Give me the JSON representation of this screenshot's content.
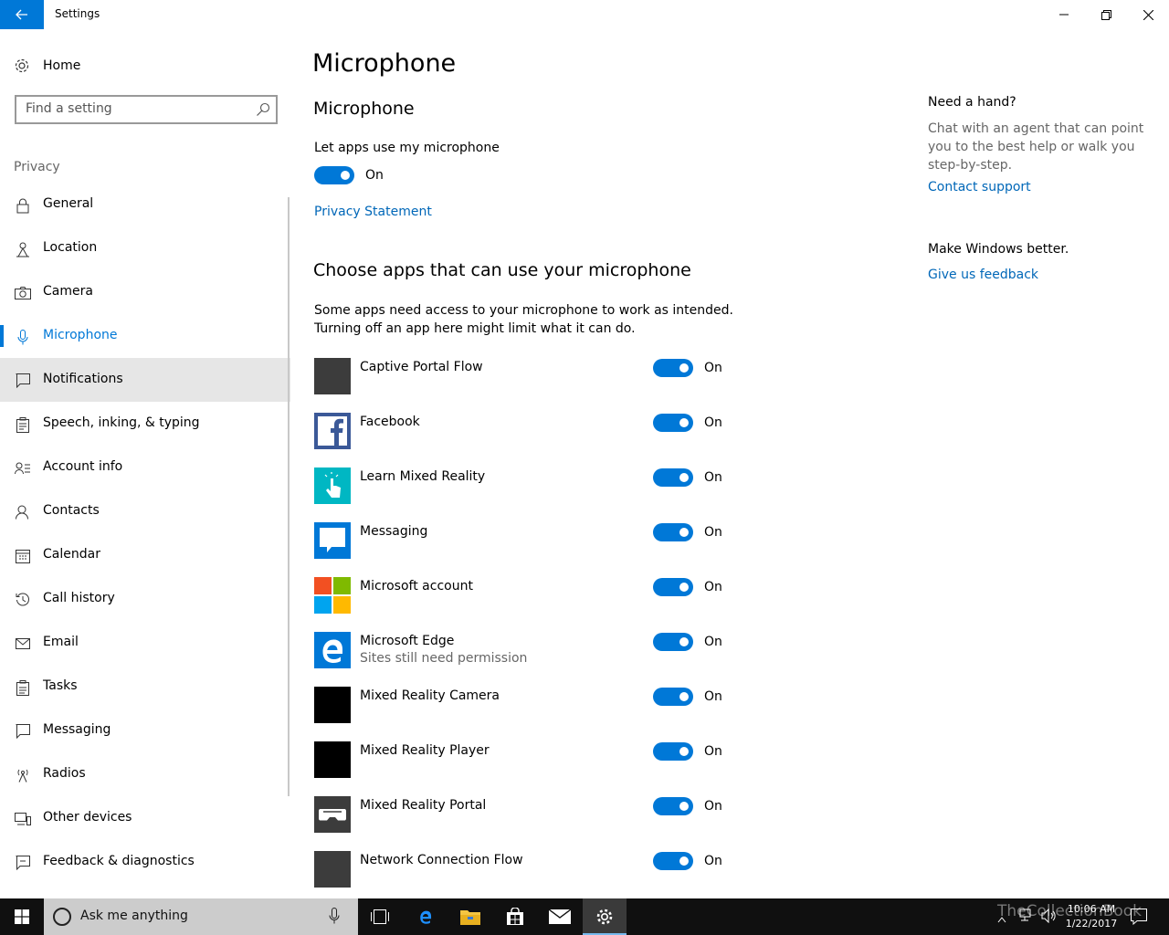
{
  "window": {
    "title": "Settings",
    "back_label": "←"
  },
  "sidebar": {
    "home_label": "Home",
    "search_placeholder": "Find a setting",
    "section_label": "Privacy",
    "items": [
      {
        "label": "General",
        "icon": "lock-icon"
      },
      {
        "label": "Location",
        "icon": "location-icon"
      },
      {
        "label": "Camera",
        "icon": "camera-icon"
      },
      {
        "label": "Microphone",
        "icon": "microphone-icon",
        "selected": true
      },
      {
        "label": "Notifications",
        "icon": "notification-icon"
      },
      {
        "label": "Speech, inking, & typing",
        "icon": "speech-icon"
      },
      {
        "label": "Account info",
        "icon": "account-icon"
      },
      {
        "label": "Contacts",
        "icon": "contacts-icon"
      },
      {
        "label": "Calendar",
        "icon": "calendar-icon"
      },
      {
        "label": "Call history",
        "icon": "history-icon"
      },
      {
        "label": "Email",
        "icon": "email-icon"
      },
      {
        "label": "Tasks",
        "icon": "tasks-icon"
      },
      {
        "label": "Messaging",
        "icon": "messaging-icon"
      },
      {
        "label": "Radios",
        "icon": "radios-icon"
      },
      {
        "label": "Other devices",
        "icon": "devices-icon"
      },
      {
        "label": "Feedback & diagnostics",
        "icon": "feedback-icon"
      }
    ]
  },
  "main": {
    "page_title": "Microphone",
    "section_title": "Microphone",
    "master_label": "Let apps use my microphone",
    "master_state": "On",
    "privacy_link": "Privacy Statement",
    "apps_heading": "Choose apps that can use your microphone",
    "apps_desc_line1": "Some apps need access to your microphone to work as intended.",
    "apps_desc_line2": "Turning off an app here might limit what it can do.",
    "apps": [
      {
        "name": "Captive Portal Flow",
        "sub": "",
        "state": "On",
        "tile_color": "#3c3c3c"
      },
      {
        "name": "Facebook",
        "sub": "",
        "state": "On",
        "tile_color": "#3b5998"
      },
      {
        "name": "Learn Mixed Reality",
        "sub": "",
        "state": "On",
        "tile_color": "#00b7c3"
      },
      {
        "name": "Messaging",
        "sub": "",
        "state": "On",
        "tile_color": "#0078d7"
      },
      {
        "name": "Microsoft account",
        "sub": "",
        "state": "On",
        "tile_color": "#ffffff"
      },
      {
        "name": "Microsoft Edge",
        "sub": "Sites still need permission",
        "state": "On",
        "tile_color": "#0078d7"
      },
      {
        "name": "Mixed Reality Camera",
        "sub": "",
        "state": "On",
        "tile_color": "#000000"
      },
      {
        "name": "Mixed Reality Player",
        "sub": "",
        "state": "On",
        "tile_color": "#000000"
      },
      {
        "name": "Mixed Reality Portal",
        "sub": "",
        "state": "On",
        "tile_color": "#3c3c3c"
      },
      {
        "name": "Network Connection Flow",
        "sub": "",
        "state": "On",
        "tile_color": "#3c3c3c"
      }
    ]
  },
  "help": {
    "title": "Need a hand?",
    "text": "Chat with an agent that can point you to the best help or walk you step-by-step.",
    "contact_link": "Contact support",
    "better_title": "Make Windows better.",
    "feedback_link": "Give us feedback"
  },
  "taskbar": {
    "search_text": "Ask me anything",
    "time": "10:06 AM",
    "date": "1/22/2017",
    "watermark": "TheCollectionBook"
  },
  "colors": {
    "accent": "#0078d7",
    "link": "#0067b8"
  }
}
